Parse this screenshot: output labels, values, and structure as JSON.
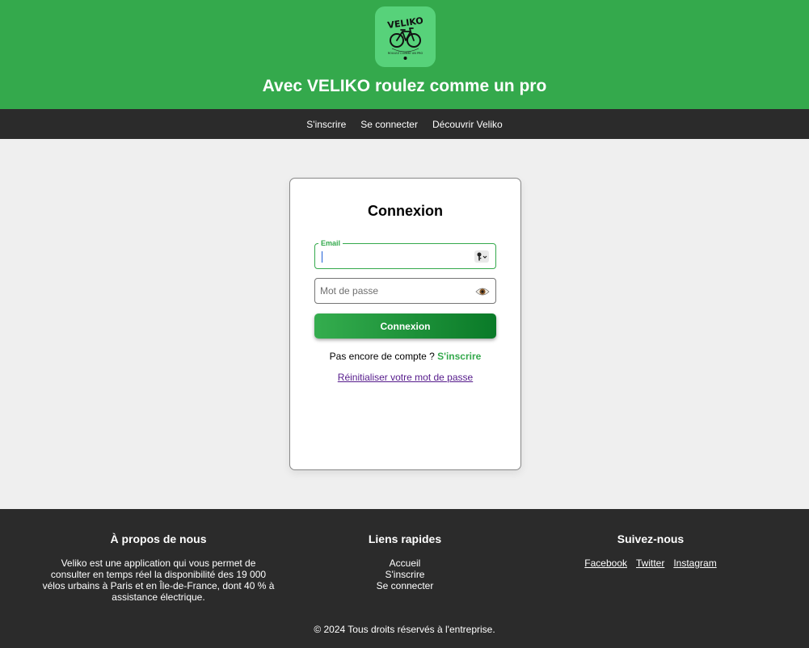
{
  "header": {
    "logo_text": "VELIKO",
    "logo_tagline": "ROULEZ COMME UN PRO",
    "title": "Avec VELIKO roulez comme un pro",
    "brand_color": "#34a94c"
  },
  "nav": {
    "items": [
      {
        "label": "S'inscrire"
      },
      {
        "label": "Se connecter"
      },
      {
        "label": "Découvrir Veliko"
      }
    ]
  },
  "login": {
    "title": "Connexion",
    "email": {
      "label": "Email",
      "value": "",
      "icon": "password-manager-key-icon"
    },
    "password": {
      "placeholder": "Mot de passe",
      "value": "",
      "icon": "eye-icon"
    },
    "submit_label": "Connexion",
    "no_account_text": "Pas encore de compte ?",
    "signup_link": "S'inscrire",
    "reset_link": "Réinitialiser votre mot de passe"
  },
  "footer": {
    "about": {
      "title": "À propos de nous",
      "text": "Veliko est une application qui vous permet de consulter en temps réel la disponibilité des 19 000 vélos urbains à Paris et en Île-de-France, dont 40 % à assistance électrique."
    },
    "quick_links": {
      "title": "Liens rapides",
      "items": [
        {
          "label": "Accueil"
        },
        {
          "label": "S'inscrire"
        },
        {
          "label": "Se connecter"
        }
      ]
    },
    "social": {
      "title": "Suivez-nous",
      "items": [
        {
          "label": "Facebook"
        },
        {
          "label": "Twitter"
        },
        {
          "label": "Instagram"
        }
      ]
    },
    "copyright": "© 2024 Tous droits réservés à l'entreprise."
  }
}
